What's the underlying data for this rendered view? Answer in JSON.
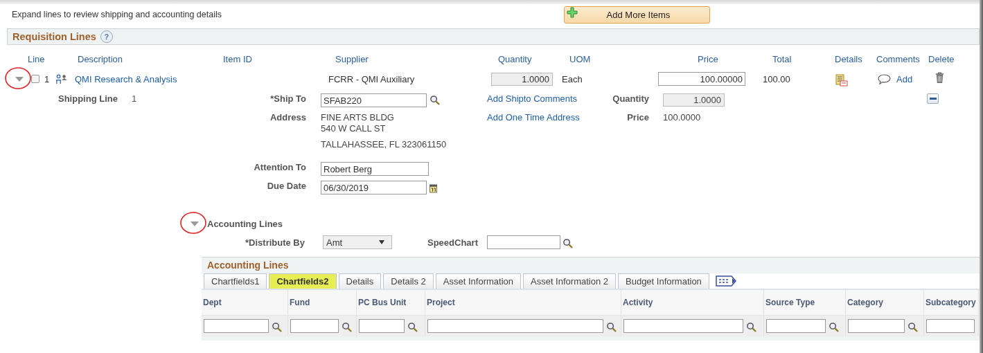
{
  "instructions": "Expand lines to review shipping and accounting details",
  "add_button": {
    "label": "Add More Items"
  },
  "requisition_lines": {
    "title": "Requisition Lines",
    "help": "?",
    "columns": [
      "Line",
      "Description",
      "Item ID",
      "Supplier",
      "Quantity",
      "UOM",
      "Price",
      "Total",
      "Details",
      "Comments",
      "Delete"
    ],
    "rows": [
      {
        "expanded": true,
        "checked": false,
        "line": "1",
        "description": "QMI Research & Analysis",
        "supplier": "FCRR - QMI Auxiliary",
        "quantity": "1.0000",
        "uom": "Each",
        "price": "100.00000",
        "total": "100.00",
        "comments_link": "Add"
      }
    ]
  },
  "shipping": {
    "label": "Shipping Line",
    "line": "1",
    "ship_to_label": "*Ship To",
    "ship_to": "SFAB220",
    "address_label": "Address",
    "address_lines": [
      "FINE ARTS BLDG",
      "540 W CALL ST",
      "TALLAHASSEE, FL  323061150"
    ],
    "attention_label": "Attention To",
    "attention": "Robert Berg",
    "due_date_label": "Due Date",
    "due_date": "06/30/2019",
    "links": [
      "Add Shipto Comments",
      "Add One Time Address"
    ],
    "quantity_label": "Quantity",
    "quantity": "1.0000",
    "price_label": "Price",
    "price": "100.0000"
  },
  "accounting": {
    "title": "Accounting Lines",
    "expanded": true,
    "distribute_by_label": "*Distribute By",
    "distribute_by": "Amt",
    "speedchart_label": "SpeedChart",
    "grid": {
      "title": "Accounting Lines",
      "tabs": [
        {
          "label": "Chartfields1",
          "selected": false
        },
        {
          "label": "Chartfields2",
          "selected": true
        },
        {
          "label": "Details",
          "selected": false
        },
        {
          "label": "Details 2",
          "selected": false
        },
        {
          "label": "Asset Information",
          "selected": false
        },
        {
          "label": "Asset Information 2",
          "selected": false
        },
        {
          "label": "Budget Information",
          "selected": false
        }
      ],
      "columns": [
        "Dept",
        "Fund",
        "PC Bus Unit",
        "Project",
        "Activity",
        "Source Type",
        "Category",
        "Subcategory"
      ]
    }
  }
}
